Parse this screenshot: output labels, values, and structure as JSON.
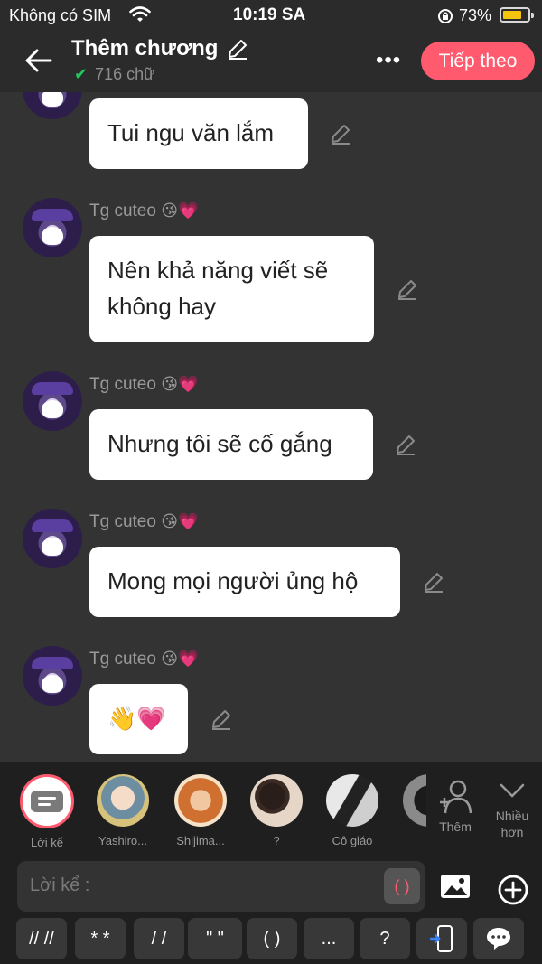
{
  "status_bar": {
    "carrier": "Không có SIM",
    "time": "10:19 SA",
    "battery_percent": "73%",
    "battery_level": 0.73
  },
  "header": {
    "title": "Thêm chương",
    "word_count": "716 chữ",
    "next_label": "Tiếp theo"
  },
  "messages": [
    {
      "author": "",
      "text": "Tui ngu văn lắm"
    },
    {
      "author": "Tg cuteo",
      "emoji": "😘💗",
      "text": "Nên khả năng viết sẽ không hay"
    },
    {
      "author": "Tg cuteo",
      "emoji": "😘💗",
      "text": "Nhưng tôi sẽ cố gắng"
    },
    {
      "author": "Tg cuteo",
      "emoji": "😘💗",
      "text": "Mong mọi người ủng hộ"
    },
    {
      "author": "Tg cuteo",
      "emoji": "😘💗",
      "text": "👋💗"
    }
  ],
  "characters": [
    {
      "name": "Lời kể"
    },
    {
      "name": "Yashiro..."
    },
    {
      "name": "Shijima..."
    },
    {
      "name": "?"
    },
    {
      "name": "Cô giáo"
    }
  ],
  "side_actions": {
    "add_label": "Thêm",
    "more_label": "Nhiều hơn"
  },
  "composer": {
    "placeholder": "Lời kể :",
    "paren_button": "( )"
  },
  "shortcut_keys": [
    "// //",
    "* *",
    "/ /",
    "\" \"",
    "( )",
    "...",
    "?"
  ],
  "colors": {
    "accent": "#ff5a6e",
    "background": "#333333",
    "panel": "#1f1f1f",
    "bubble": "#ffffff"
  }
}
